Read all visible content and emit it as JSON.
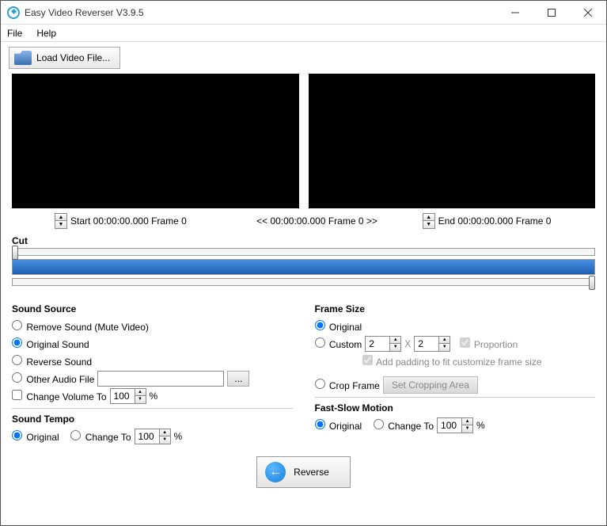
{
  "window": {
    "title": "Easy Video Reverser V3.9.5"
  },
  "menu": {
    "file": "File",
    "help": "Help"
  },
  "toolbar": {
    "load": "Load Video File..."
  },
  "time": {
    "start": "Start 00:00:00.000 Frame 0",
    "center": "<< 00:00:00.000  Frame 0 >>",
    "end": "End 00:00:00.000 Frame 0"
  },
  "cut": {
    "label": "Cut"
  },
  "sound_source": {
    "title": "Sound Source",
    "remove": "Remove Sound (Mute Video)",
    "original": "Original Sound",
    "reverse": "Reverse Sound",
    "other": "Other Audio File",
    "change_volume": "Change Volume To",
    "volume_value": "100",
    "percent": "%"
  },
  "sound_tempo": {
    "title": "Sound Tempo",
    "original": "Original",
    "change_to": "Change To",
    "value": "100",
    "percent": "%"
  },
  "frame_size": {
    "title": "Frame Size",
    "original": "Original",
    "custom": "Custom",
    "w": "2",
    "h": "2",
    "x": "X",
    "proportion": "Proportion",
    "padding": "Add padding to fit customize frame size",
    "crop": "Crop Frame",
    "set_crop": "Set Cropping Area"
  },
  "motion": {
    "title": "Fast-Slow Motion",
    "original": "Original",
    "change_to": "Change To",
    "value": "100",
    "percent": "%"
  },
  "bottom": {
    "reverse": "Reverse"
  },
  "browse": "..."
}
